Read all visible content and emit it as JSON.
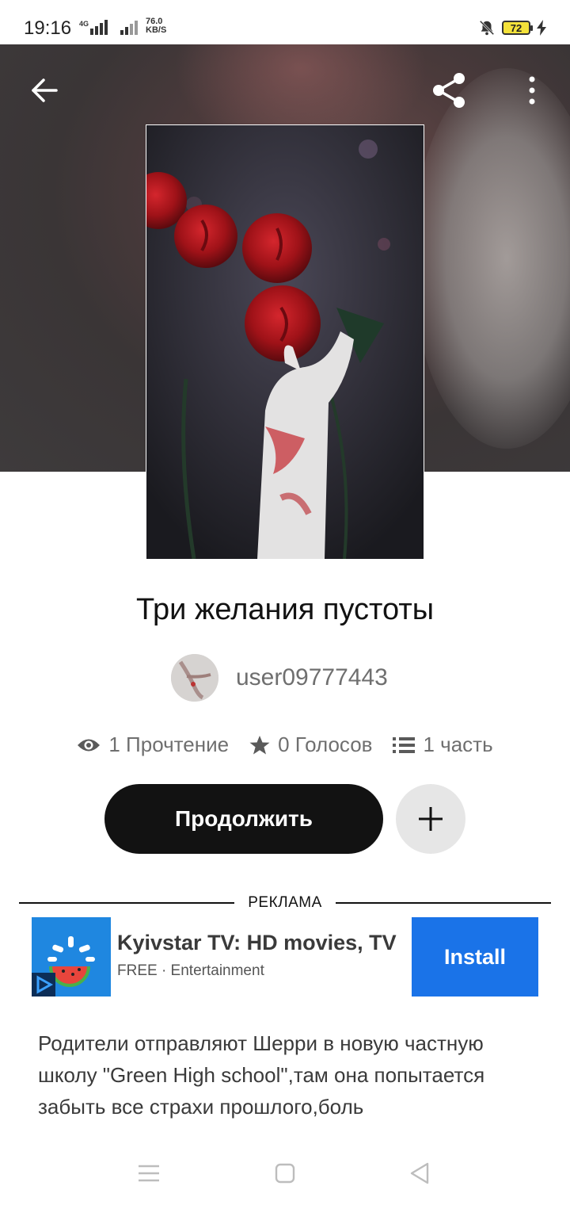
{
  "status_bar": {
    "time": "19:16",
    "network_type": "4G",
    "speed_value": "76.0",
    "speed_unit": "KB/S",
    "battery_level": "72"
  },
  "header": {
    "back_icon": "arrow-left-icon",
    "share_icon": "share-icon",
    "more_icon": "more-vertical-icon"
  },
  "story": {
    "title": "Три желания пустоты",
    "author": "user09777443",
    "stats": {
      "reads": "1 Прочтение",
      "votes": "0 Голосов",
      "parts": "1 часть"
    },
    "continue_label": "Продолжить",
    "description": "Родители отправляют Шерри в новую частную школу \"Green High school\",там она попытается забыть все страхи прошлого,боль"
  },
  "ad": {
    "label": "РЕКЛАМА",
    "app_title": "Kyivstar TV: HD movies, TV",
    "app_subtitle": "FREE · Entertainment",
    "install_label": "Install"
  },
  "colors": {
    "primary_button": "#121212",
    "install_button": "#1a73e8",
    "ad_icon_bg": "#1f87e0"
  }
}
